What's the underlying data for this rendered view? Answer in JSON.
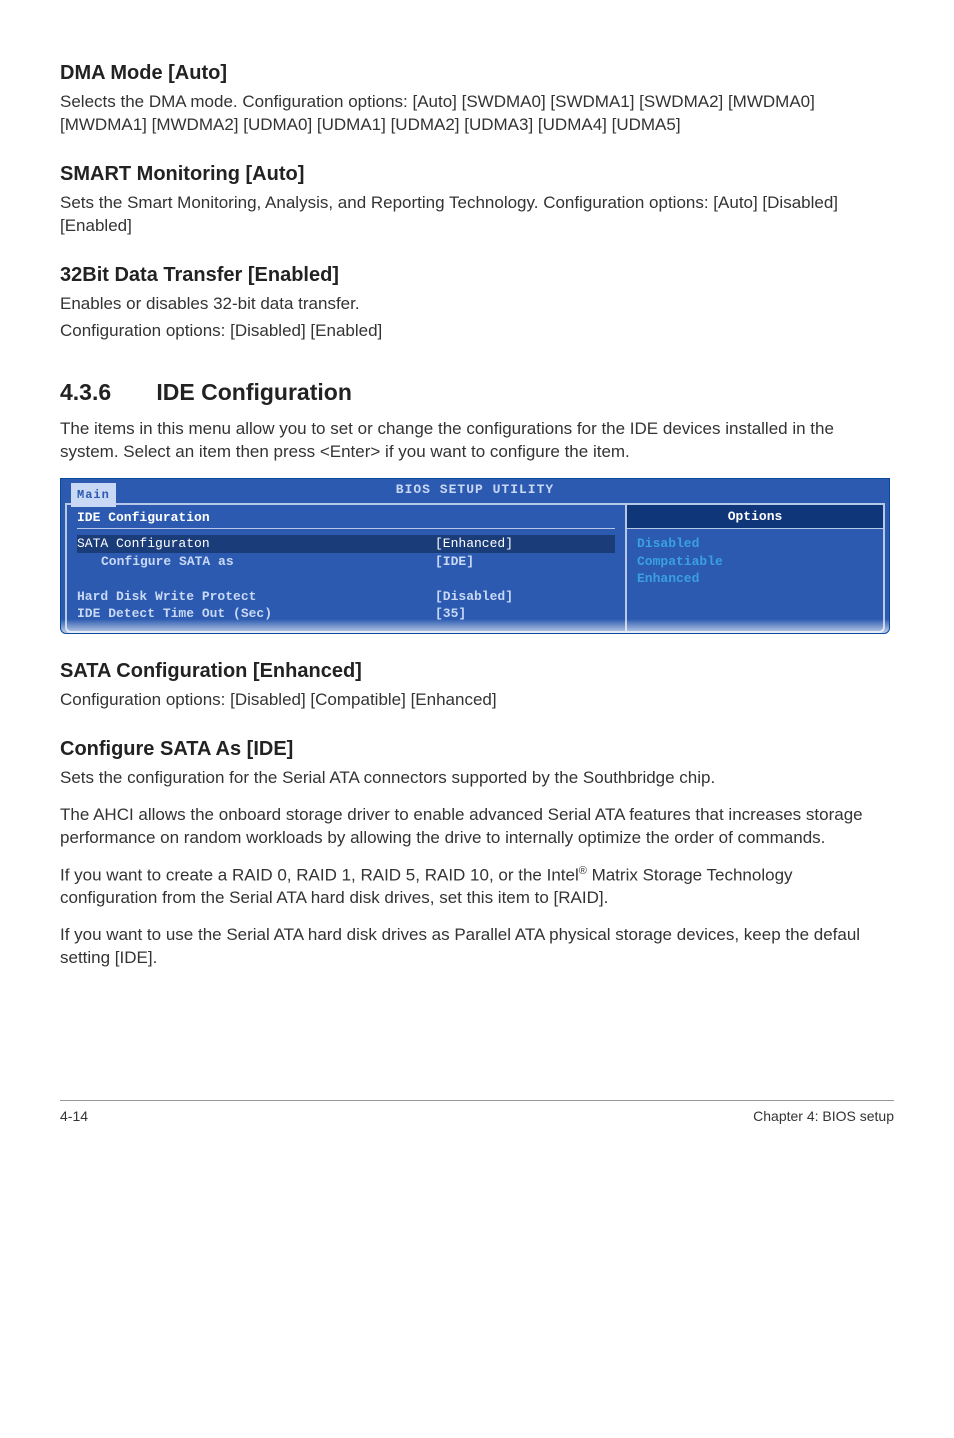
{
  "dma": {
    "title": "DMA Mode [Auto]",
    "body": "Selects the DMA mode. Configuration options: [Auto] [SWDMA0] [SWDMA1] [SWDMA2] [MWDMA0] [MWDMA1] [MWDMA2] [UDMA0] [UDMA1] [UDMA2] [UDMA3] [UDMA4] [UDMA5]"
  },
  "smart": {
    "title": "SMART Monitoring [Auto]",
    "body": "Sets the Smart Monitoring, Analysis, and Reporting Technology. Configuration options: [Auto] [Disabled] [Enabled]"
  },
  "bit32": {
    "title": "32Bit Data Transfer [Enabled]",
    "body1": "Enables or disables 32-bit data transfer.",
    "body2": "Configuration options: [Disabled] [Enabled]"
  },
  "section": {
    "num": "4.3.6",
    "title": "IDE Configuration",
    "intro": "The items in this menu allow you to set or change the configurations for the IDE devices installed in the system. Select an item then press <Enter> if you want to configure the item."
  },
  "bios": {
    "topTitle": "BIOS SETUP UTILITY",
    "tab": "Main",
    "leftHeader": "IDE Configuration",
    "rightHeader": "Options",
    "rows": [
      {
        "k": "SATA Configuraton",
        "v": "[Enhanced]",
        "hl": true
      },
      {
        "k": "Configure SATA as",
        "v": "[IDE]",
        "indent": true,
        "bold": true
      },
      {
        "k": " ",
        "v": " "
      },
      {
        "k": "Hard Disk Write Protect",
        "v": "[Disabled]",
        "bold": true
      },
      {
        "k": "IDE Detect Time Out (Sec)",
        "v": "[35]",
        "bold": true
      }
    ],
    "options": [
      "Disabled",
      "Compatiable",
      "Enhanced"
    ]
  },
  "sataConf": {
    "title": "SATA Configuration [Enhanced]",
    "body": "Configuration options: [Disabled] [Compatible] [Enhanced]"
  },
  "confSata": {
    "title": "Configure SATA As [IDE]",
    "p1": "Sets the configuration for the Serial ATA connectors supported by the Southbridge chip.",
    "p2": "The AHCI allows the onboard storage driver to enable advanced Serial ATA features that increases storage performance on random workloads by allowing the drive to internally optimize the order of commands.",
    "p3a": "If you want to create a RAID 0, RAID 1,  RAID 5,  RAID 10, or the Intel",
    "p3sup": "®",
    "p3b": " Matrix Storage Technology configuration from the Serial ATA hard disk drives, set this item to [RAID].",
    "p4": "If you want to use the Serial ATA hard disk drives as Parallel ATA physical storage devices, keep the defaul setting [IDE]."
  },
  "footer": {
    "left": "4-14",
    "right": "Chapter 4: BIOS setup"
  }
}
